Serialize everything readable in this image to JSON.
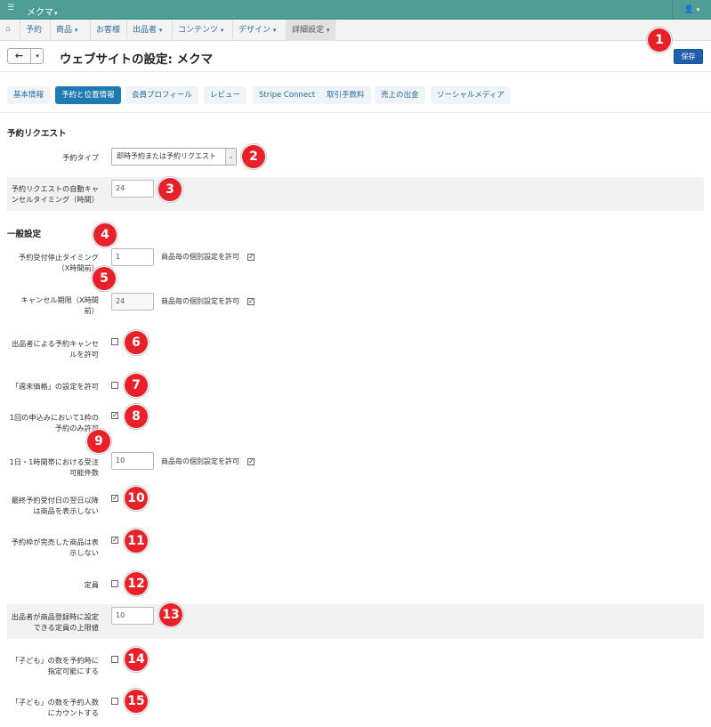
{
  "topbar": {
    "menu_icon": "list-icon",
    "brand": "メクマ",
    "user_icon": "user-icon"
  },
  "nav": {
    "home_icon": "home-icon",
    "items": [
      {
        "label": "予約",
        "caret": ""
      },
      {
        "label": "商品",
        "caret": "▾"
      },
      {
        "label": "お客様",
        "caret": ""
      },
      {
        "label": "出品者",
        "caret": "▾"
      },
      {
        "label": "コンテンツ",
        "caret": "▾"
      },
      {
        "label": "デザイン",
        "caret": "▾"
      },
      {
        "label": "詳細設定",
        "caret": "▾"
      }
    ]
  },
  "header": {
    "back_icon": "arrow-left-icon",
    "title": "ウェブサイトの設定: メクマ",
    "save": "保存"
  },
  "tabs": [
    "基本情報",
    "予約と位置情報",
    "会員プロフィール",
    "レビュー",
    "Stripe Connect",
    "取引手数料",
    "売上の出金",
    "ソーシャルメディア"
  ],
  "active_tab": "予約と位置情報",
  "sections": {
    "request": "予約リクエスト",
    "general": "一般設定"
  },
  "fields": {
    "reservation_type_label": "予約タイプ",
    "reservation_type_value": "即時予約または予約リクエスト",
    "auto_cancel_label_1": "予約リクエストの自動キャ",
    "auto_cancel_label_2": "ンセルタイミング（時間）",
    "auto_cancel_value": "24",
    "stop_label_1": "予約受付停止タイミング",
    "stop_label_2": "（X時間前）",
    "stop_value": "1",
    "cancel_label_1": "キャンセル期限（X時間",
    "cancel_label_2": "前）",
    "cancel_value": "24",
    "per_product": "商品毎の個別設定を許可",
    "seller_cancel_label_1": "出品者による予約キャンセ",
    "seller_cancel_label_2": "ルを許可",
    "weekend_price_label": "「週末価格」の設定を許可",
    "one_slot_label_1": "1回の申込みにおいて1枠の",
    "one_slot_label_2": "予約のみ許可",
    "hourly_label_1": "1日・1時間帯における受注",
    "hourly_label_2": "可能件数",
    "hourly_value": "10",
    "hide_after_label_1": "最終予約受付日の翌日以降",
    "hide_after_label_2": "は商品を表示しない",
    "hide_full_label_1": "予約枠が完売した商品は表",
    "hide_full_label_2": "示しない",
    "capacity_label": "定員",
    "cap_limit_label_1": "出品者が商品登録時に設定",
    "cap_limit_label_2": "できる定員の上限値",
    "cap_limit_value": "10",
    "child_label_1": "「子ども」の数を予約時に",
    "child_label_2": "指定可能にする",
    "child_count_label_1": "「子ども」の数を予約人数",
    "child_count_label_2": "にカウントする"
  },
  "checkboxes": {
    "stop_per_product": true,
    "cancel_per_product": true,
    "seller_cancel": false,
    "weekend_price": false,
    "one_slot": true,
    "hourly_per_product": true,
    "hide_after": true,
    "hide_full": true,
    "capacity": false,
    "child": false,
    "child_count": false
  },
  "badges": [
    "1",
    "2",
    "3",
    "4",
    "5",
    "6",
    "7",
    "8",
    "9",
    "10",
    "11",
    "12",
    "13",
    "14",
    "15"
  ],
  "colors": {
    "topbar": "#4f9e96",
    "primary": "#1f5fae",
    "active_tab": "#1f7ab3",
    "badge": "#e8202a"
  }
}
